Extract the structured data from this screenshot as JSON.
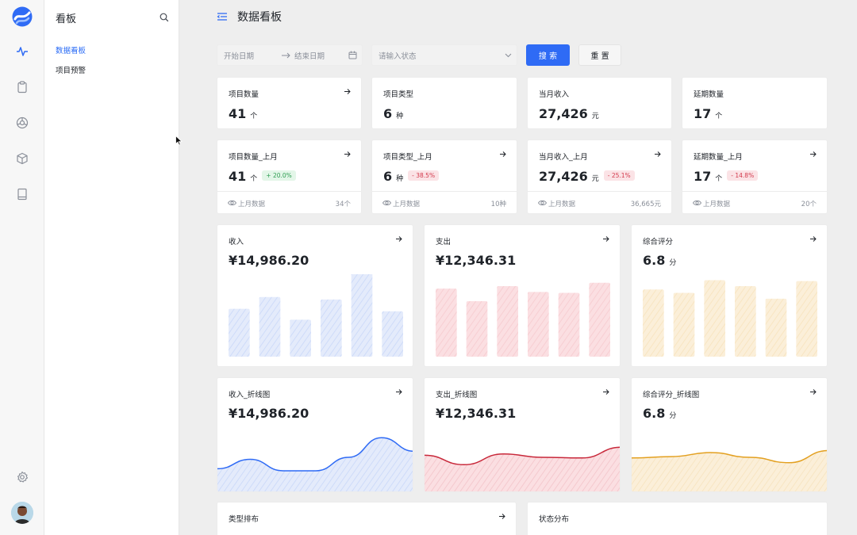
{
  "app": {
    "subnav_title": "看板",
    "subnav_items": [
      {
        "label": "数据看板",
        "active": true
      },
      {
        "label": "项目预警",
        "active": false
      }
    ]
  },
  "rail_icons": [
    "activity-icon",
    "clipboard-icon",
    "aperture-icon",
    "box-icon",
    "book-icon",
    "settings-icon"
  ],
  "page": {
    "title": "数据看板"
  },
  "filters": {
    "start_placeholder": "开始日期",
    "end_placeholder": "结束日期",
    "status_placeholder": "请输入状态",
    "search_label": "搜 索",
    "reset_label": "重 置"
  },
  "stats": [
    {
      "title": "项目数量",
      "value": "41",
      "unit": "个"
    },
    {
      "title": "项目类型",
      "value": "6",
      "unit": "种"
    },
    {
      "title": "当月收入",
      "value": "27,426",
      "unit": "元"
    },
    {
      "title": "延期数量",
      "value": "17",
      "unit": "个"
    }
  ],
  "compare_stats": [
    {
      "title": "项目数量_上月",
      "value": "41",
      "unit": "个",
      "change": "+ 20.0%",
      "trend": "up",
      "foot_label": "上月数据",
      "foot_value": "34个"
    },
    {
      "title": "项目类型_上月",
      "value": "6",
      "unit": "种",
      "change": "- 38.5%",
      "trend": "down",
      "foot_label": "上月数据",
      "foot_value": "10种"
    },
    {
      "title": "当月收入_上月",
      "value": "27,426",
      "unit": "元",
      "change": "- 25.1%",
      "trend": "down",
      "foot_label": "上月数据",
      "foot_value": "36,665元"
    },
    {
      "title": "延期数量_上月",
      "value": "17",
      "unit": "个",
      "change": "- 14.8%",
      "trend": "down",
      "foot_label": "上月数据",
      "foot_value": "20个"
    }
  ],
  "bar_cards": [
    {
      "title": "收入",
      "value": "¥14,986.20",
      "unit": "",
      "color": "#2f6bf5",
      "fill": "#e4ebfb"
    },
    {
      "title": "支出",
      "value": "¥12,346.31",
      "unit": "",
      "color": "#e0505e",
      "fill": "#fbdfe2"
    },
    {
      "title": "综合评分",
      "value": "6.8",
      "unit": "分",
      "color": "#e8a21c",
      "fill": "#fbefd9"
    }
  ],
  "line_cards": [
    {
      "title": "收入_折线图",
      "value": "¥14,986.20",
      "unit": "",
      "color": "#2f6bf5",
      "fill": "#e4ebfb"
    },
    {
      "title": "支出_折线图",
      "value": "¥12,346.31",
      "unit": "",
      "color": "#c8283a",
      "fill": "#fbdfe2"
    },
    {
      "title": "综合评分_折线图",
      "value": "6.8",
      "unit": "分",
      "color": "#e3a020",
      "fill": "#fbefd9"
    }
  ],
  "bottom_cards": [
    {
      "title": "类型排布"
    },
    {
      "title": "状态分布"
    }
  ],
  "chart_data": [
    {
      "type": "bar",
      "series": [
        {
          "values": [
            0.57,
            0.71,
            0.44,
            0.68,
            1.0,
            0.54
          ]
        }
      ],
      "ylim": [
        0,
        1
      ]
    },
    {
      "type": "bar",
      "series": [
        {
          "values": [
            0.81,
            0.66,
            0.84,
            0.77,
            0.76,
            0.88
          ]
        }
      ],
      "ylim": [
        0,
        1
      ]
    },
    {
      "type": "bar",
      "series": [
        {
          "values": [
            0.8,
            0.76,
            0.91,
            0.84,
            0.69,
            0.9
          ]
        }
      ],
      "ylim": [
        0,
        1
      ]
    },
    {
      "type": "area",
      "series": [
        {
          "values": [
            0.36,
            0.5,
            0.33,
            0.33,
            0.53,
            0.82,
            0.62
          ]
        }
      ],
      "ylim": [
        0,
        1
      ]
    },
    {
      "type": "area",
      "series": [
        {
          "values": [
            0.56,
            0.42,
            0.58,
            0.53,
            0.52,
            0.68
          ]
        }
      ],
      "ylim": [
        0,
        1
      ]
    },
    {
      "type": "area",
      "series": [
        {
          "values": [
            0.52,
            0.54,
            0.6,
            0.53,
            0.45,
            0.63
          ]
        }
      ],
      "ylim": [
        0,
        1
      ]
    }
  ]
}
